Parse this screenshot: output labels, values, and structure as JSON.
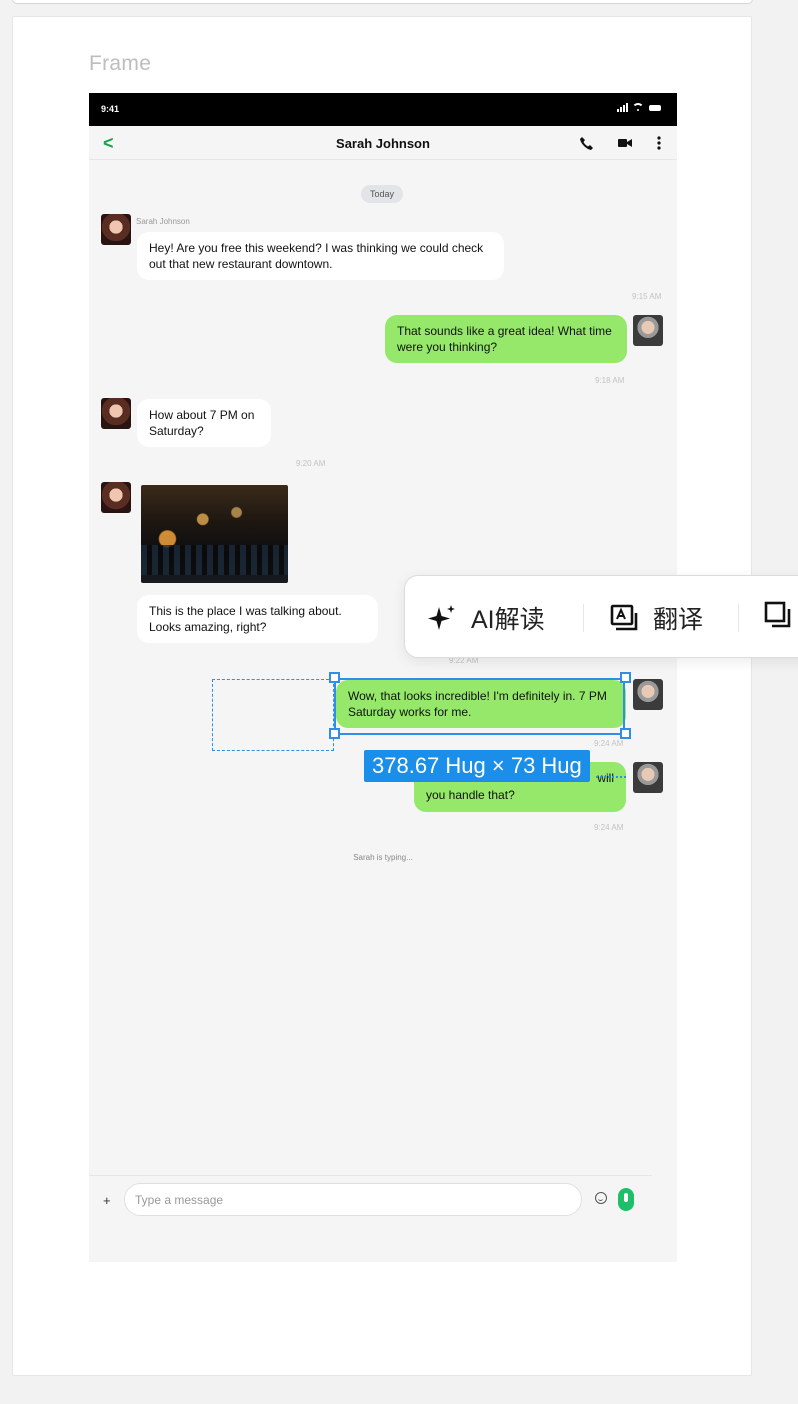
{
  "frame": {
    "label": "Frame"
  },
  "status_bar": {
    "time": "9:41"
  },
  "chat_header": {
    "back_glyph": "<",
    "title": "Sarah Johnson"
  },
  "date_divider": "Today",
  "messages": [
    {
      "from": "Sarah Johnson",
      "sender_label": "Sarah Johnson",
      "text": "Hey! Are you free this weekend? I was thinking we could check out that new restaurant downtown.",
      "time": "9:15 AM"
    },
    {
      "from": "me",
      "text": "That sounds like a great idea! What time were you thinking?",
      "time": "9:18 AM"
    },
    {
      "from": "Sarah Johnson",
      "text": "How about 7 PM on Saturday?",
      "time": "9:20 AM"
    },
    {
      "from": "Sarah Johnson",
      "image": "restaurant-photo",
      "text": "This is the place I was talking about. Looks amazing, right?",
      "time": "9:22 AM"
    },
    {
      "from": "me",
      "text": "Wow, that looks incredible! I'm definitely in. 7 PM Saturday works for me.",
      "time": "9:24 AM"
    },
    {
      "from": "me",
      "text_visible": "will",
      "text_line2": "you handle that?",
      "time": "9:24 AM"
    }
  ],
  "typing_indicator": "Sarah is typing...",
  "composer": {
    "plus_glyph": "+",
    "placeholder": "Type a message"
  },
  "selection": {
    "dimension_label": "378.67 Hug × 73 Hug"
  },
  "floating_toolbar": {
    "ai_label": "AI解读",
    "translate_label": "翻译"
  },
  "colors": {
    "accent_green": "#17a34a",
    "outgoing_bubble": "#95e86a",
    "selection_blue": "#2f8fe8",
    "mic_green": "#1fbf6a"
  }
}
